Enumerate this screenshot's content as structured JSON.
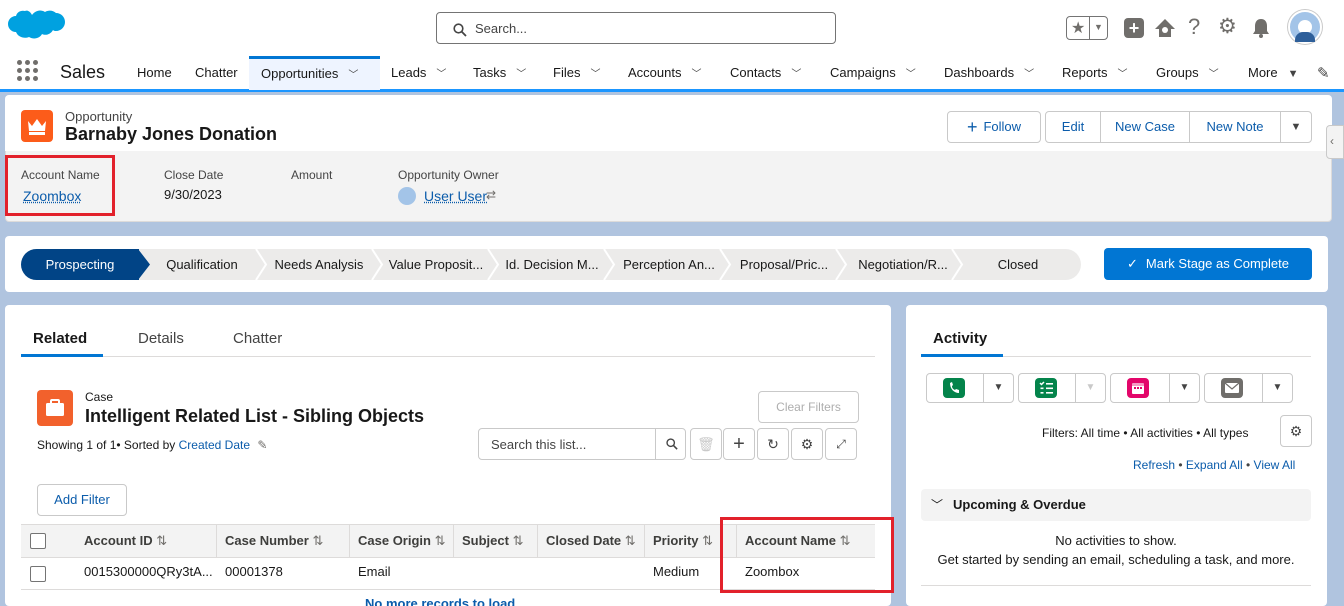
{
  "header": {
    "search_placeholder": "Search..."
  },
  "nav": {
    "app_name": "Sales",
    "items": [
      {
        "label": "Home"
      },
      {
        "label": "Chatter"
      },
      {
        "label": "Opportunities"
      },
      {
        "label": "Leads"
      },
      {
        "label": "Tasks"
      },
      {
        "label": "Files"
      },
      {
        "label": "Accounts"
      },
      {
        "label": "Contacts"
      },
      {
        "label": "Campaigns"
      },
      {
        "label": "Dashboards"
      },
      {
        "label": "Reports"
      },
      {
        "label": "Groups"
      },
      {
        "label": "More"
      }
    ]
  },
  "record": {
    "object_label": "Opportunity",
    "name": "Barnaby Jones Donation",
    "buttons": {
      "follow": "Follow",
      "edit": "Edit",
      "new_case": "New Case",
      "new_note": "New Note"
    },
    "fields": {
      "account_name_label": "Account Name",
      "account_name_value": "Zoombox",
      "close_date_label": "Close Date",
      "close_date_value": "9/30/2023",
      "amount_label": "Amount",
      "owner_label": "Opportunity Owner",
      "owner_value": "User User"
    }
  },
  "path": {
    "stages": [
      "Prospecting",
      "Qualification",
      "Needs Analysis",
      "Value Proposit...",
      "Id. Decision M...",
      "Perception An...",
      "Proposal/Pric...",
      "Negotiation/R...",
      "Closed"
    ],
    "mark_button": "Mark Stage as Complete"
  },
  "left_tabs": [
    "Related",
    "Details",
    "Chatter"
  ],
  "related_list": {
    "object_label": "Case",
    "title": "Intelligent Related List - Sibling Objects",
    "showing": "Showing 1 of 1• Sorted by",
    "sorted_by": "Created Date",
    "clear_filters": "Clear Filters",
    "search_placeholder": "Search this list...",
    "add_filter": "Add Filter",
    "columns": [
      "Account ID",
      "Case Number",
      "Case Origin",
      "Subject",
      "Closed Date",
      "Priority",
      "Account Name"
    ],
    "rows": [
      {
        "account_id": "0015300000QRy3tA...",
        "case_number": "00001378",
        "case_origin": "Email",
        "subject": "",
        "closed_date": "",
        "priority": "Medium",
        "account_name": "Zoombox"
      }
    ],
    "footer": "No more records to load"
  },
  "activity": {
    "tab": "Activity",
    "filters": "Filters: All time • All activities • All types",
    "refresh": "Refresh",
    "expand_all": "Expand All",
    "view_all": "View All",
    "upcoming": "Upcoming & Overdue",
    "empty_1": "No activities to show.",
    "empty_2": "Get started by sending an email, scheduling a task, and more."
  },
  "colors": {
    "brand": "#0176d3",
    "path_current": "#014486",
    "highlight_box": "#e2212b",
    "opportunity_icon": "#fc5c1a",
    "case_icon": "#f2612c"
  }
}
